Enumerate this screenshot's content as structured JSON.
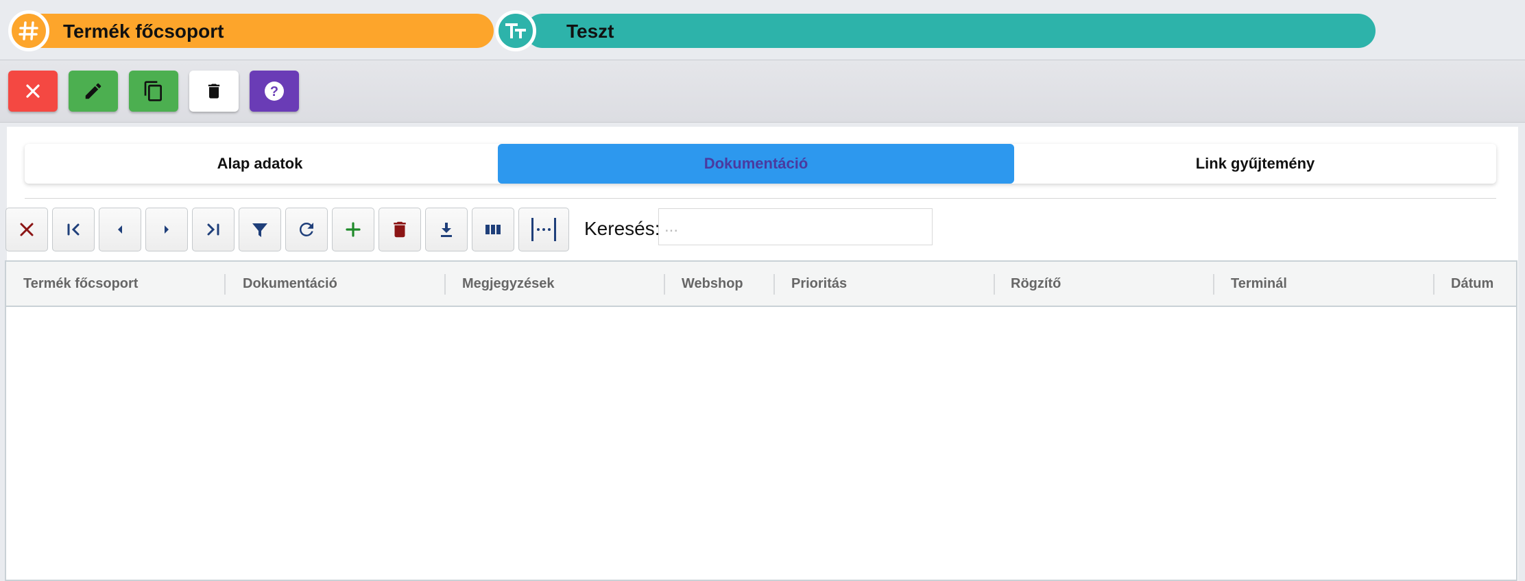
{
  "header": {
    "group_label": "Termék főcsoport",
    "group_icon": "hash-icon",
    "name_label": "Teszt",
    "name_icon": "text-type-icon",
    "colors": {
      "orange": "#fda52b",
      "teal": "#2db3aa"
    }
  },
  "toolbar": {
    "buttons": [
      {
        "name": "close",
        "icon": "close-icon",
        "color": "#f44842"
      },
      {
        "name": "edit",
        "icon": "pencil-icon",
        "color": "#4caf50"
      },
      {
        "name": "copy",
        "icon": "copy-icon",
        "color": "#4caf50"
      },
      {
        "name": "delete",
        "icon": "trash-icon",
        "color": "#ffffff"
      },
      {
        "name": "help",
        "icon": "help-icon",
        "color": "#6a3cb6"
      }
    ]
  },
  "tabs": [
    {
      "label": "Alap adatok",
      "active": false
    },
    {
      "label": "Dokumentáció",
      "active": true
    },
    {
      "label": "Link gyűjtemény",
      "active": false
    }
  ],
  "grid_toolbar": {
    "buttons": [
      "close-icon",
      "first-page-icon",
      "prev-icon",
      "next-icon",
      "last-page-icon",
      "filter-icon",
      "refresh-icon",
      "add-icon",
      "trash-icon",
      "download-icon",
      "columns-icon",
      "fit-width-icon"
    ],
    "search_label": "Keresés:",
    "search_placeholder": "...",
    "search_value": ""
  },
  "grid": {
    "columns": [
      "Termék főcsoport",
      "Dokumentáció",
      "Megjegyzések",
      "Webshop",
      "Prioritás",
      "Rögzítő",
      "Terminál",
      "Dátum"
    ],
    "rows": []
  }
}
